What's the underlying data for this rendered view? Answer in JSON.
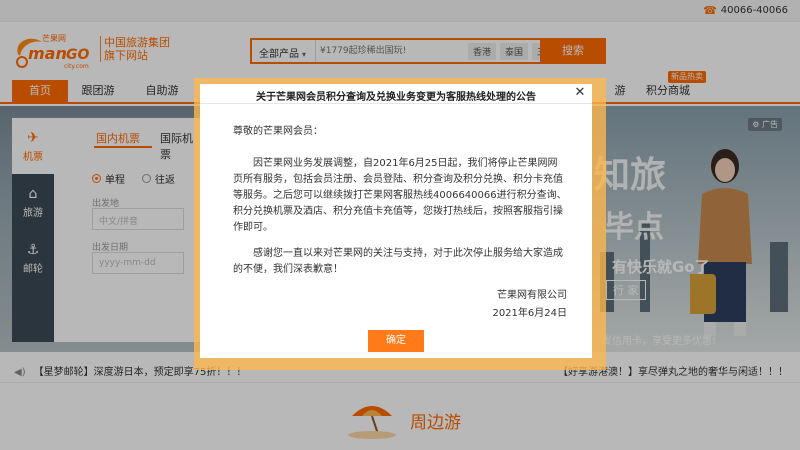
{
  "topbar": {
    "phone": "40066-40066"
  },
  "brand": {
    "logo_cn": "芒果网",
    "logo_en_1": "man",
    "logo_en_2": "GO",
    "logo_sub": "city.com",
    "group_line1": "中国旅游集团",
    "group_line2": "旗下网站"
  },
  "search": {
    "category": "全部产品",
    "placeholder": "¥1779起珍稀出国玩!",
    "tags": [
      "香港",
      "泰国",
      "三亚"
    ],
    "button": "搜索"
  },
  "nav": {
    "items": [
      "首页",
      "跟团游",
      "自助游",
      "游",
      "积分商城"
    ],
    "new_badge": "新品热卖"
  },
  "booking": {
    "tabs": [
      {
        "label": "机票",
        "icon": "✈"
      },
      {
        "label": "旅游",
        "icon": "⌂"
      },
      {
        "label": "邮轮",
        "icon": "⚓"
      }
    ],
    "subtabs": [
      "国内机票",
      "国际机票"
    ],
    "trip_types": [
      "单程",
      "往返"
    ],
    "from_label": "出发地",
    "from_placeholder": "中文/拼音",
    "date_label": "出发日期",
    "date_placeholder": "yyyy-mm-dd"
  },
  "hero": {
    "ad_label": "广告",
    "slogan": "有快乐就Go了",
    "tag": "行 家",
    "credit": "发信用卡，享受更多优惠!"
  },
  "ticker": {
    "left": "【星梦邮轮】深度游日本，预定即享75折！！！",
    "right": "【好享游港澳！】享尽弹丸之地的奢华与闲适！！！"
  },
  "section": {
    "title": "周边游"
  },
  "modal": {
    "title": "关于芒果网会员积分查询及兑换业务变更为客服热线处理的公告",
    "greeting": "尊敬的芒果网会员：",
    "paragraph1": "因芒果网业务发展调整，自2021年6月25日起，我们将停止芒果网网页所有服务，包括会员注册、会员登陆、积分查询及积分兑换、积分卡充值等服务。之后您可以继续拨打芒果网客服热线4006640066进行积分查询、积分兑换机票及酒店、积分充值卡充值等，您拨打热线后，按照客服指引操作即可。",
    "paragraph2": "感谢您一直以来对芒果网的关注与支持，对于此次停止服务给大家造成的不便，我们深表歉意！",
    "signature": "芒果网有限公司",
    "date": "2021年6月24日",
    "confirm": "确定"
  }
}
